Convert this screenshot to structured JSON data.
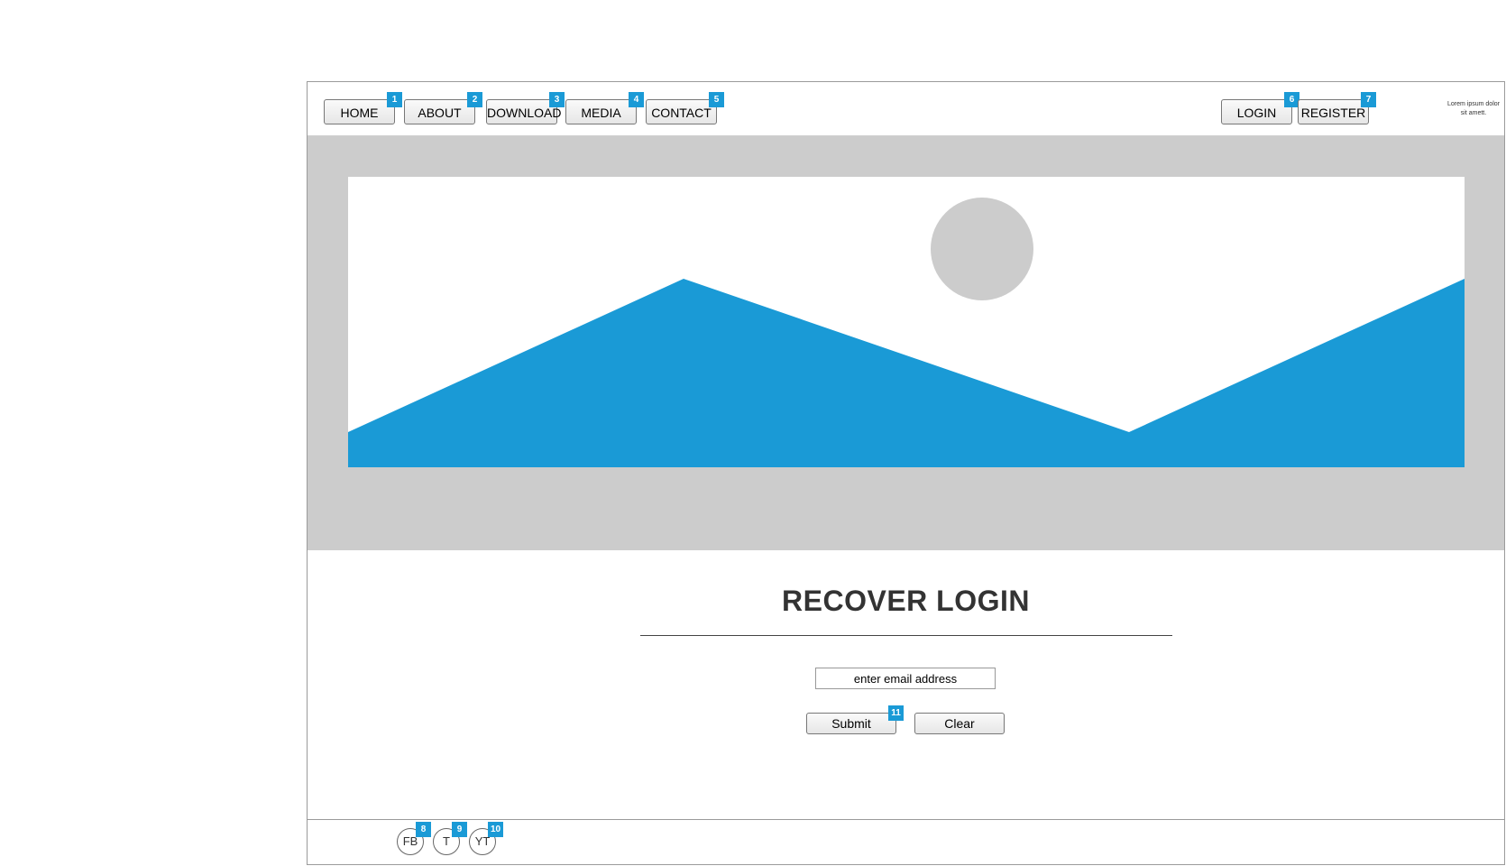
{
  "header": {
    "nav": [
      {
        "label": "HOME",
        "badge": "1"
      },
      {
        "label": "ABOUT",
        "badge": "2"
      },
      {
        "label": "DOWNLOAD",
        "badge": "3"
      },
      {
        "label": "MEDIA",
        "badge": "4"
      },
      {
        "label": "CONTACT",
        "badge": "5"
      }
    ],
    "auth": [
      {
        "label": "LOGIN",
        "badge": "6"
      },
      {
        "label": "REGISTER",
        "badge": "7"
      }
    ],
    "lorem_text": "Lorem ipsum dolor sit amett."
  },
  "main": {
    "title": "RECOVER LOGIN",
    "email_placeholder": "enter email address",
    "submit_label": "Submit",
    "submit_badge": "11",
    "clear_label": "Clear"
  },
  "footer": {
    "social": [
      {
        "label": "FB",
        "badge": "8"
      },
      {
        "label": "T",
        "badge": "9"
      },
      {
        "label": "YT",
        "badge": "10"
      }
    ]
  },
  "colors": {
    "accent": "#1a9ad6",
    "hero_bg": "#cccccc",
    "title": "#333333"
  },
  "icons": {
    "hero": "image-placeholder-icon"
  }
}
